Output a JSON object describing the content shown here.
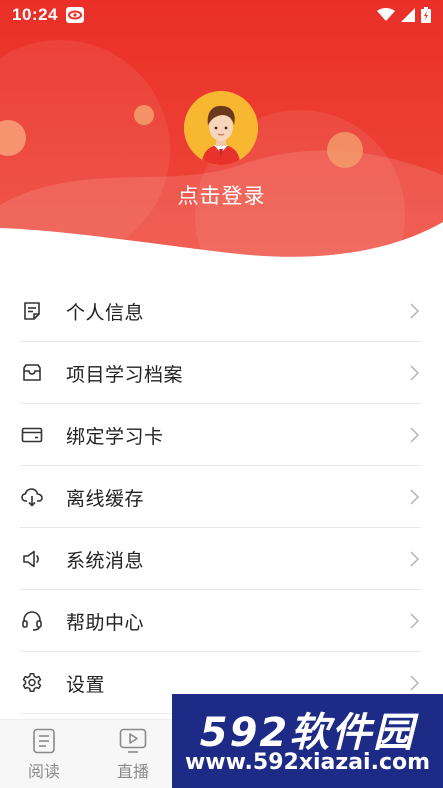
{
  "status_bar": {
    "time": "10:24"
  },
  "profile": {
    "login_prompt": "点击登录"
  },
  "menu": {
    "items": [
      {
        "label": "个人信息",
        "icon": "note-icon"
      },
      {
        "label": "项目学习档案",
        "icon": "inbox-icon"
      },
      {
        "label": "绑定学习卡",
        "icon": "card-icon"
      },
      {
        "label": "离线缓存",
        "icon": "cloud-download-icon"
      },
      {
        "label": "系统消息",
        "icon": "speaker-icon"
      },
      {
        "label": "帮助中心",
        "icon": "headset-icon"
      },
      {
        "label": "设置",
        "icon": "gear-icon"
      }
    ]
  },
  "tabbar": {
    "tabs": [
      {
        "label": "阅读",
        "icon": "document-icon"
      },
      {
        "label": "直播",
        "icon": "video-icon"
      }
    ]
  },
  "watermark": {
    "brand": "592软件园",
    "url": "www.592xiazai.com"
  },
  "colors": {
    "primary_red": "#e8322b",
    "avatar_bg": "#f7b730",
    "watermark_bg": "#1d2a86"
  }
}
